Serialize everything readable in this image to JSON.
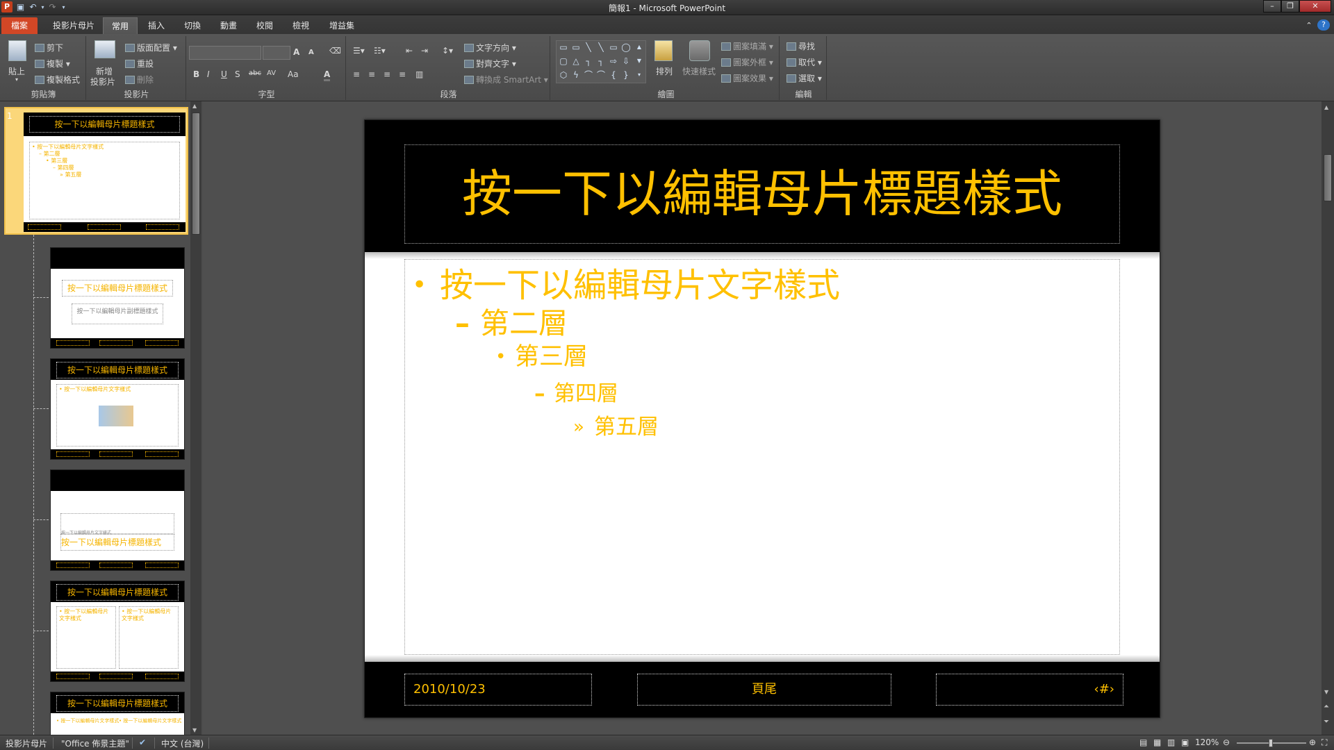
{
  "window": {
    "title": "簡報1 - Microsoft PowerPoint",
    "app_icon": "P"
  },
  "tabs": [
    {
      "label": "檔案"
    },
    {
      "label": "投影片母片"
    },
    {
      "label": "常用"
    },
    {
      "label": "插入"
    },
    {
      "label": "切換"
    },
    {
      "label": "動畫"
    },
    {
      "label": "校閱"
    },
    {
      "label": "檢視"
    },
    {
      "label": "增益集"
    }
  ],
  "ribbon": {
    "clipboard": {
      "paste": "貼上",
      "cut": "剪下",
      "copy": "複製",
      "format_painter": "複製格式",
      "label": "剪貼簿"
    },
    "slides": {
      "new_slide_1": "新增",
      "new_slide_2": "投影片",
      "layout": "版面配置",
      "reset": "重設",
      "delete": "刪除",
      "label": "投影片"
    },
    "font": {
      "bold": "B",
      "italic": "I",
      "underline": "U",
      "shadow": "S",
      "strike": "abc",
      "spacing": "AV",
      "case": "Aa",
      "color": "A",
      "grow": "A",
      "shrink": "A",
      "label": "字型"
    },
    "paragraph": {
      "text_direction": "文字方向",
      "align_text": "對齊文字",
      "smartart": "轉換成 SmartArt",
      "label": "段落"
    },
    "drawing": {
      "arrange": "排列",
      "quick_styles": "快速樣式",
      "fill": "圖案填滿",
      "outline": "圖案外框",
      "effects": "圖案效果",
      "label": "繪圖"
    },
    "editing": {
      "find": "尋找",
      "replace": "取代",
      "select": "選取",
      "label": "編輯"
    }
  },
  "thumbnails": {
    "first_number": "1",
    "t1_title": "按一下以編輯母片標題樣式",
    "t1_l1": "• 按一下以編輯母片文字樣式",
    "t1_l2": "– 第二層",
    "t1_l3": "• 第三層",
    "t1_l4": "– 第四層",
    "t1_l5": "» 第五層",
    "t2_title": "按一下以編輯母片標題樣式",
    "t2_sub": "按一下以編輯母片副標題樣式",
    "t3_title": "按一下以編輯母片標題樣式",
    "t3_l1": "• 按一下以編輯母片文字樣式",
    "t4_small": "按一下以編輯母片文字樣式",
    "t4_title": "按一下以編輯母片標題樣式",
    "t5_title": "按一下以編輯母片標題樣式",
    "t5_col": "• 按一下以編輯母片文字樣式",
    "t6_title": "按一下以編輯母片標題樣式",
    "t6_col": "• 按一下以編輯母片文字樣式"
  },
  "slide": {
    "title": "按一下以編輯母片標題樣式",
    "levels": [
      {
        "bullet": "•",
        "text": "按一下以編輯母片文字樣式"
      },
      {
        "bullet": "–",
        "text": "第二層"
      },
      {
        "bullet": "•",
        "text": "第三層"
      },
      {
        "bullet": "–",
        "text": "第四層"
      },
      {
        "bullet": "»",
        "text": "第五層"
      }
    ],
    "footer_date": "2010/10/23",
    "footer_text": "頁尾",
    "footer_num": "‹#›"
  },
  "status": {
    "view": "投影片母片",
    "theme": "\"Office 佈景主題\"",
    "language": "中文 (台灣)",
    "zoom": "120%"
  },
  "colors": {
    "accent": "#ffc000",
    "file_tab": "#d24726",
    "slide_band": "#000000"
  }
}
